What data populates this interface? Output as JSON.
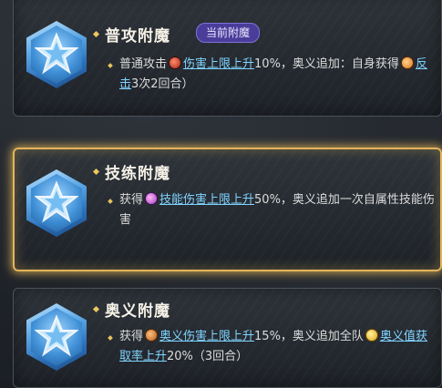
{
  "cards": [
    {
      "title": "普攻附魔",
      "badge": "当前附魔",
      "desc": {
        "bullet": "·",
        "before": "普通攻击",
        "link1": "伤害上限上升",
        "mid": "10%，奥义追加：自身获得",
        "link2": "反击",
        "after": "3次2回合）"
      }
    },
    {
      "title": "技练附魔",
      "desc": {
        "bullet": "·",
        "before": "获得",
        "link1": "技能伤害上限上升",
        "after": "50%，奥义追加一次自属性技能伤害"
      }
    },
    {
      "title": "奥义附魔",
      "desc": {
        "bullet": "·",
        "before": "获得",
        "link1": "奥义伤害上限上升",
        "mid": "15%，奥义追加全队",
        "link2": "奥义值获取率上升",
        "after": "20%（3回合）"
      }
    }
  ],
  "icons": {
    "card_emblem": "blue-star-hex-icon",
    "damage_cap_icon": "red-damage-icon",
    "counter_icon": "orange-counter-icon",
    "skill_icon": "purple-skill-icon",
    "ougi_icon": "copper-ougi-icon",
    "ougi_gauge_icon": "gold-gauge-icon"
  },
  "colors": {
    "selected_border": "#e2b45a",
    "link": "#7fd3ff",
    "badge_bg": "#4a3d9a"
  }
}
